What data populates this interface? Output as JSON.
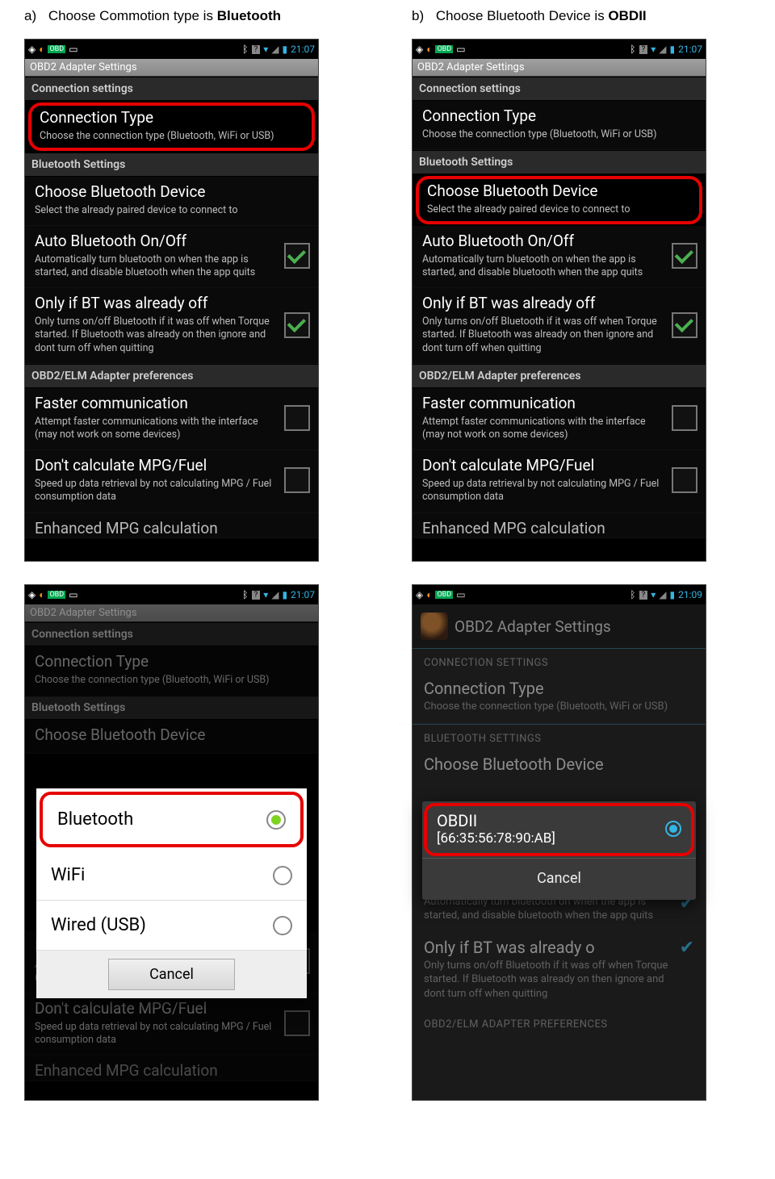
{
  "steps": {
    "a": {
      "tag": "a)",
      "prefix": "Choose Commotion type is ",
      "bold": "Bluetooth"
    },
    "b": {
      "tag": "b)",
      "prefix": "Choose Bluetooth Device is ",
      "bold": "OBDII"
    }
  },
  "status": {
    "time_a": "21:07",
    "time_d": "21:09"
  },
  "titlebar": "OBD2 Adapter Settings",
  "sections": {
    "connection": "Connection settings",
    "bluetooth": "Bluetooth Settings",
    "adapter": "OBD2/ELM Adapter preferences",
    "connection_upper": "CONNECTION SETTINGS",
    "bluetooth_upper": "BLUETOOTH SETTINGS",
    "adapter_upper": "OBD2/ELM ADAPTER PREFERENCES"
  },
  "items": {
    "conn_type": {
      "title": "Connection Type",
      "sub": "Choose the connection type (Bluetooth, WiFi or USB)"
    },
    "choose_bt": {
      "title": "Choose Bluetooth Device",
      "sub": "Select the already paired device to connect to"
    },
    "auto_bt": {
      "title": "Auto Bluetooth On/Off",
      "sub": "Automatically turn bluetooth on when the app is started, and disable bluetooth when the app quits"
    },
    "only_off": {
      "title": "Only if BT was already off",
      "sub": "Only turns on/off Bluetooth if it was off when Torque started. If Bluetooth was already on then ignore and dont turn off when quitting"
    },
    "faster": {
      "title": "Faster communication",
      "sub": "Attempt faster communications with the interface (may not work on some devices)"
    },
    "no_mpg": {
      "title": "Don't calculate MPG/Fuel",
      "sub": "Speed up data retrieval by not calculating MPG / Fuel consumption data"
    },
    "enh_mpg": {
      "title": "Enhanced MPG calculation"
    },
    "only_off_holo": {
      "title": "Only if BT was already o",
      "sub": "Only turns on/off Bluetooth if it was off when Torque started. If Bluetooth was already on then ignore and dont turn off when quitting"
    }
  },
  "conn_dialog": {
    "opt1": "Bluetooth",
    "opt2": "WiFi",
    "opt3": "Wired (USB)",
    "cancel": "Cancel"
  },
  "dev_dialog": {
    "name": "OBDII",
    "mac": "[66:35:56:78:90:AB]",
    "cancel": "Cancel"
  }
}
